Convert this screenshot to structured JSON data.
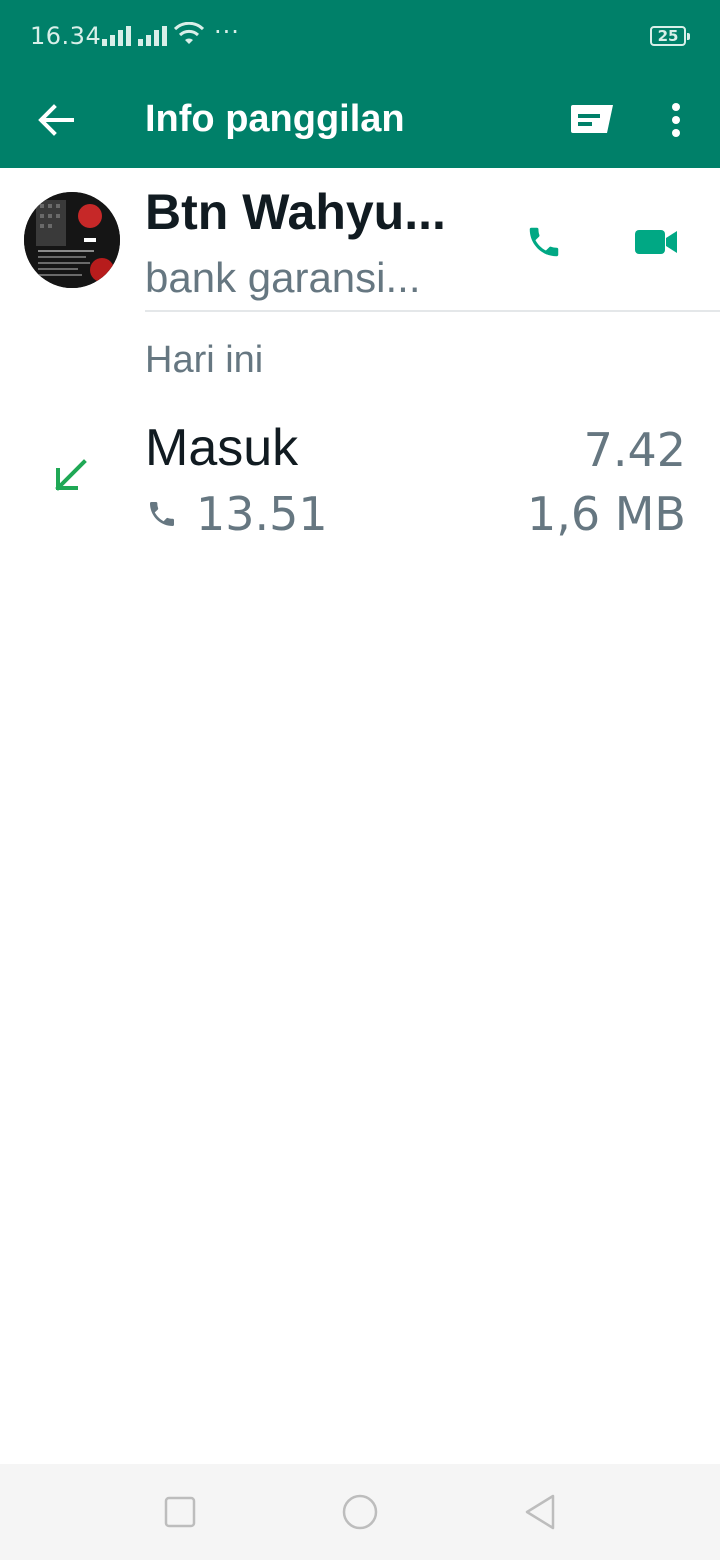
{
  "status_bar": {
    "time": "16.34",
    "overflow": "···",
    "battery": "25"
  },
  "toolbar": {
    "title": "Info panggilan",
    "back_icon": "arrow-left-icon",
    "message_icon": "chat-message-icon",
    "more_icon": "more-vert-icon"
  },
  "contact": {
    "name": "Btn Wahyu...",
    "status": "bank garansi..."
  },
  "section": {
    "date_label": "Hari ini"
  },
  "call_log": [
    {
      "type": "Masuk",
      "time": "7.42",
      "duration": "13.51",
      "size": "1,6 MB",
      "direction_icon": "incoming-arrow-icon"
    }
  ],
  "colors": {
    "primary": "#008069",
    "accent": "#00a884",
    "incoming": "#1fa855",
    "text_primary": "#111b21",
    "text_secondary": "#667781"
  }
}
